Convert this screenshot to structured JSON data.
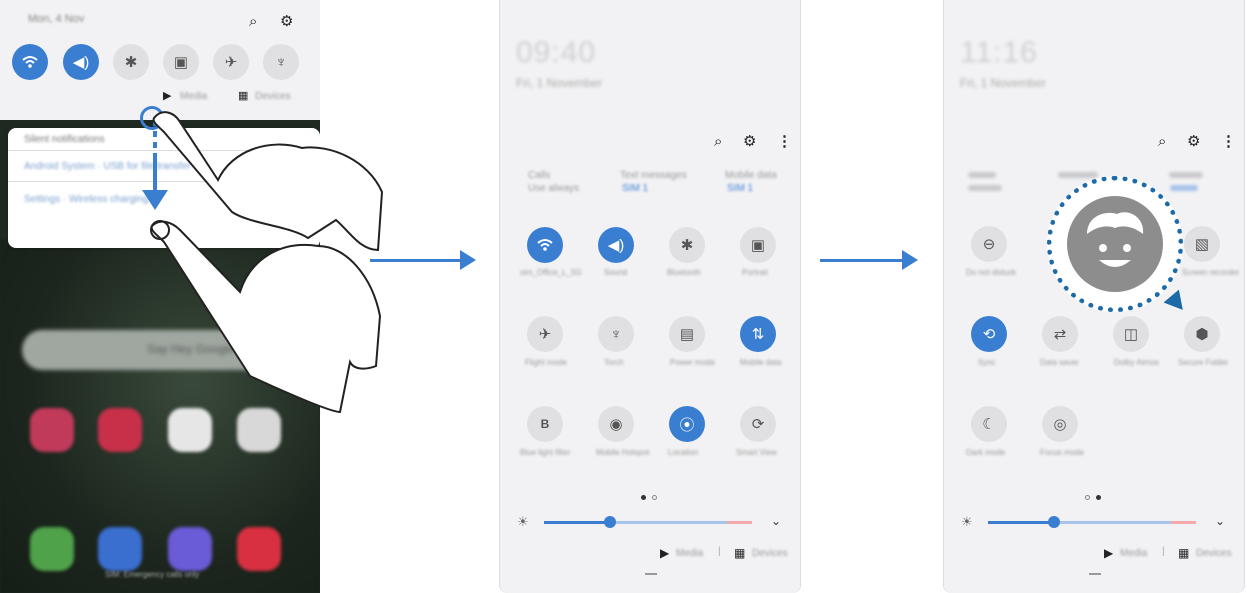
{
  "panel1": {
    "date": "Mon, 4 Nov",
    "media_label": "Media",
    "devices_label": "Devices",
    "notif_header": "Silent notifications",
    "notif1": "Android System · USB for file transfer",
    "notif2": "Settings · Wireless charging",
    "search_placeholder": "Say Hey Google",
    "emergency": "SIM: Emergency calls only"
  },
  "panel2": {
    "time": "09:40",
    "date": "Fri, 1 November",
    "network1": "Calls",
    "network1_sub": "Use always",
    "network2": "Text messages",
    "network2_sub": "SIM 1",
    "network3": "Mobile data",
    "network3_sub": "SIM 1",
    "tiles": [
      {
        "label": "sim_Office_L_5G"
      },
      {
        "label": "Sound"
      },
      {
        "label": "Bluetooth"
      },
      {
        "label": "Portrait"
      },
      {
        "label": "Flight mode"
      },
      {
        "label": "Torch"
      },
      {
        "label": "Power mode"
      },
      {
        "label": "Mobile data"
      },
      {
        "label": "Blue light filter"
      },
      {
        "label": "Mobile Hotspot"
      },
      {
        "label": "Location"
      },
      {
        "label": "Smart View"
      }
    ],
    "media_label": "Media",
    "devices_label": "Devices"
  },
  "panel3": {
    "time": "11:16",
    "date": "Fri, 1 November",
    "tiles": [
      {
        "label": "Do not disturb"
      },
      {
        "label": "Screen recorder"
      },
      {
        "label": "Sync"
      },
      {
        "label": "Data saver"
      },
      {
        "label": "Dolby Atmos"
      },
      {
        "label": "Secure Folder"
      },
      {
        "label": "Dark mode"
      },
      {
        "label": "Focus mode"
      }
    ],
    "media_label": "Media",
    "devices_label": "Devices"
  },
  "colors": {
    "accent": "#3a7ed2",
    "panel_bg": "#f2f2f4",
    "home_bg": "#1f2b20"
  }
}
